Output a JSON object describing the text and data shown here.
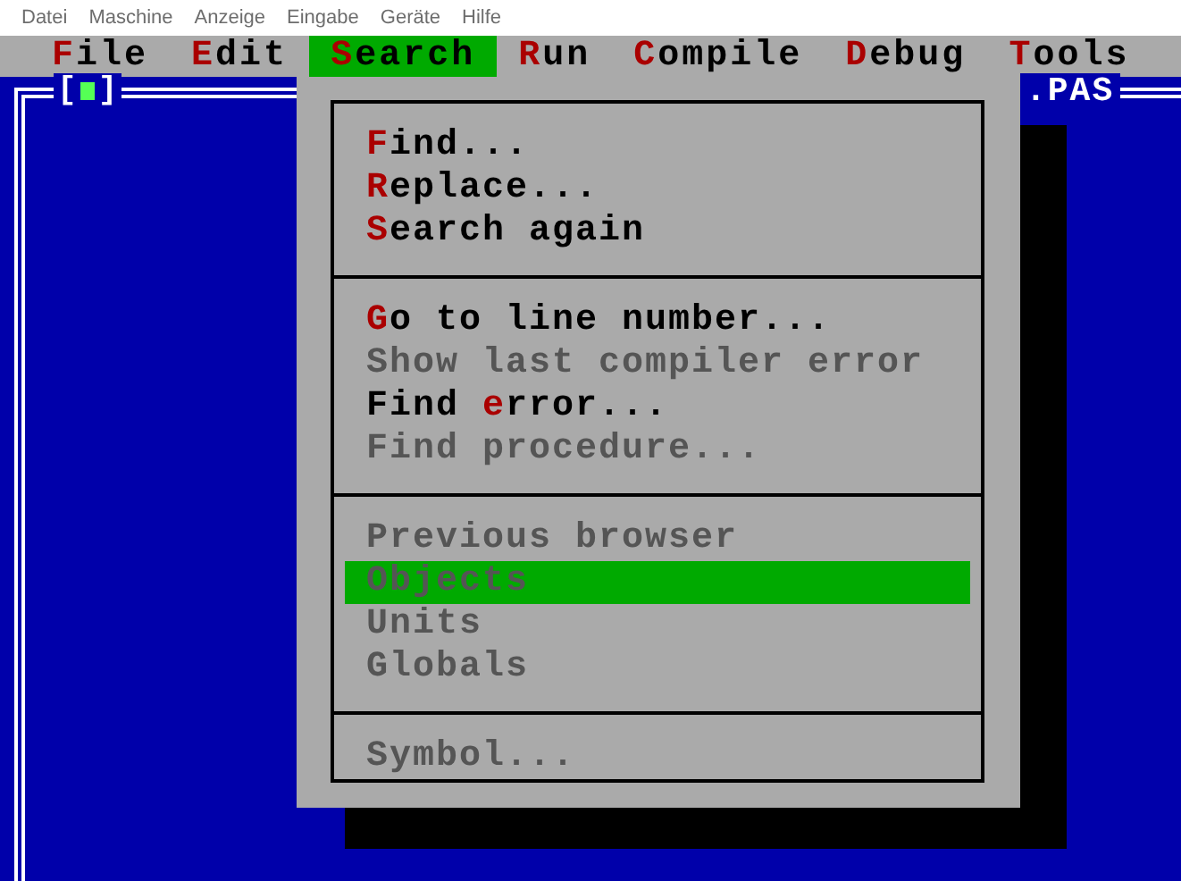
{
  "host_menu": [
    "Datei",
    "Maschine",
    "Anzeige",
    "Eingabe",
    "Geräte",
    "Hilfe"
  ],
  "menu_bar": [
    {
      "key": "F",
      "post": "ile",
      "selected": false
    },
    {
      "key": "E",
      "post": "dit",
      "selected": false
    },
    {
      "key": "S",
      "post": "earch",
      "selected": true
    },
    {
      "key": "R",
      "post": "un",
      "selected": false
    },
    {
      "key": "C",
      "post": "ompile",
      "selected": false
    },
    {
      "key": "D",
      "post": "ebug",
      "selected": false
    },
    {
      "key": "T",
      "post": "ools",
      "selected": false
    }
  ],
  "window": {
    "bracket_open": "[",
    "bracket_close": "]",
    "title": ".PAS"
  },
  "dropdown": {
    "groups": [
      [
        {
          "key": "F",
          "post": "ind...",
          "disabled": false,
          "selected": false
        },
        {
          "key": "R",
          "post": "eplace...",
          "disabled": false,
          "selected": false
        },
        {
          "key": "S",
          "post": "earch again",
          "disabled": false,
          "selected": false
        }
      ],
      [
        {
          "key": "G",
          "post": "o to line number...",
          "disabled": false,
          "selected": false
        },
        {
          "text": "Show last compiler error",
          "disabled": true,
          "selected": false
        },
        {
          "pre": "Find ",
          "key": "e",
          "post": "rror...",
          "disabled": false,
          "selected": false
        },
        {
          "text": "Find procedure...",
          "disabled": true,
          "selected": false
        }
      ],
      [
        {
          "text": "Previous browser",
          "disabled": true,
          "selected": false
        },
        {
          "text": "Objects",
          "disabled": true,
          "selected": true
        },
        {
          "text": "Units",
          "disabled": true,
          "selected": false
        },
        {
          "text": "Globals",
          "disabled": true,
          "selected": false
        }
      ],
      [
        {
          "text": "Symbol...",
          "disabled": true,
          "selected": false
        }
      ]
    ]
  }
}
